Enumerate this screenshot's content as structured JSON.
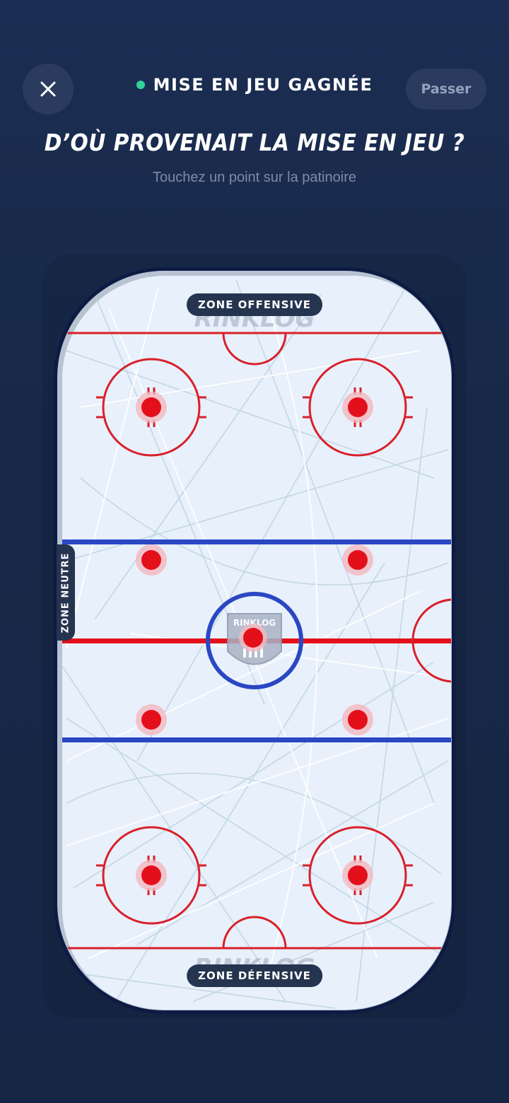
{
  "header": {
    "status_text": "MISE EN JEU GAGNÉE",
    "skip_label": "Passer",
    "close_icon": "close-icon",
    "status_color": "#2fd39a"
  },
  "question": {
    "title": "D’OÙ PROVENAIT LA MISE EN JEU ?",
    "hint": "Touchez un point sur la patinoire"
  },
  "rink": {
    "zone_top": "ZONE OFFENSIVE",
    "zone_bottom": "ZONE DÉFENSIVE",
    "zone_side": "ZONE NEUTRE",
    "watermark": "RINKLOG",
    "logo_text": "RINKLOG",
    "colors": {
      "ice": "#e8f0fb",
      "red_line": "#d8202a",
      "blue_line": "#2a47c4",
      "dot": "#e3101b",
      "border": "#0d1b44"
    }
  }
}
